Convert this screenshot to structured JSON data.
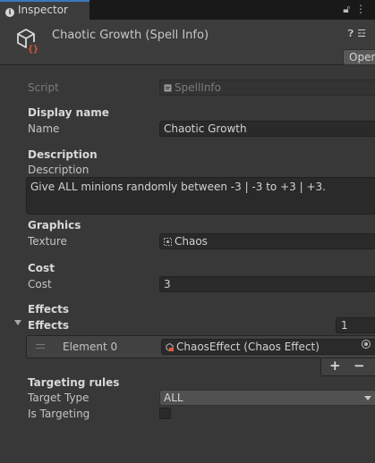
{
  "tab": {
    "label": "Inspector"
  },
  "header": {
    "title": "Chaotic Growth (Spell Info)",
    "open_label": "Open"
  },
  "script": {
    "label": "Script",
    "value": "SpellInfo"
  },
  "sections": {
    "display_name": "Display name",
    "description": "Description",
    "graphics": "Graphics",
    "cost": "Cost",
    "effects": "Effects",
    "targeting": "Targeting rules"
  },
  "fields": {
    "name_label": "Name",
    "name_value": "Chaotic Growth",
    "description_label": "Description",
    "description_value": "Give ALL minions randomly between -3 | -3 to +3 | +3.",
    "texture_label": "Texture",
    "texture_value": "Chaos",
    "cost_label": "Cost",
    "cost_value": "3",
    "effects_label": "Effects",
    "effects_count": "1",
    "element0_label": "Element 0",
    "element0_value": "ChaosEffect (Chaos Effect)",
    "target_type_label": "Target Type",
    "target_type_value": "ALL",
    "is_targeting_label": "Is Targeting",
    "is_targeting_checked": false
  },
  "list_buttons": {
    "add": "+",
    "remove": "−"
  },
  "colors": {
    "accent": "#3a79bb",
    "asset_icon": "#e25b3a",
    "script_icon": "#9a9a9a"
  }
}
